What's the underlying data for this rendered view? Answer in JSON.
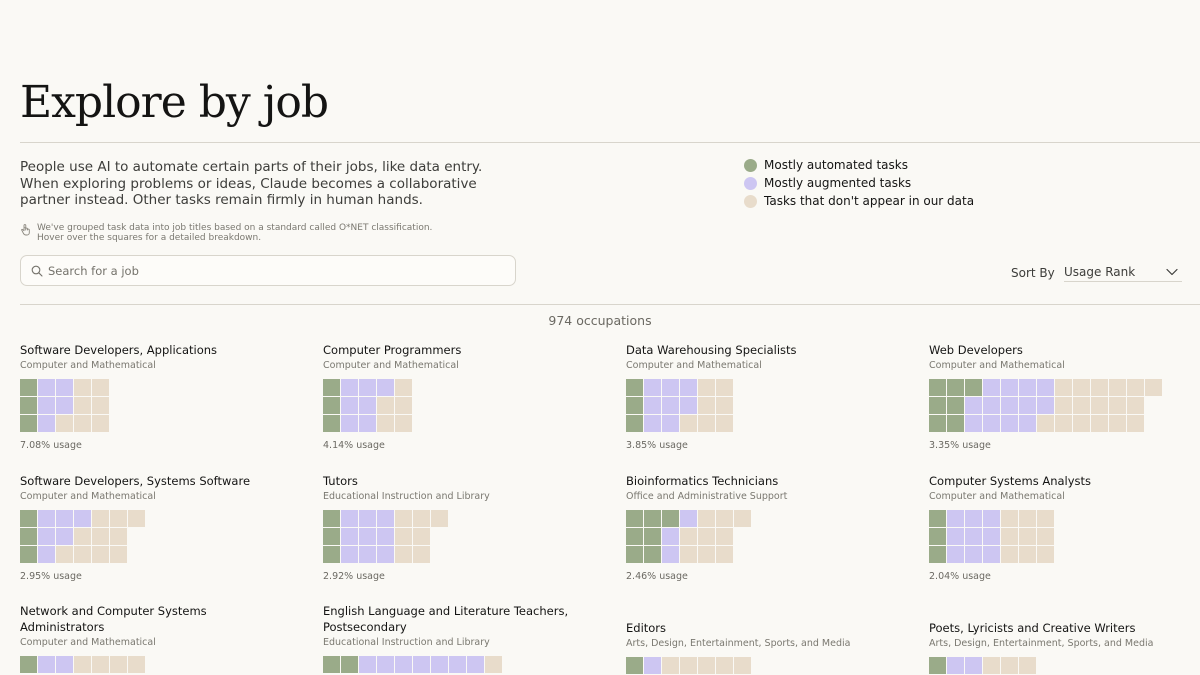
{
  "header": {
    "title": "Explore by job"
  },
  "intro": {
    "text": "People use AI to automate certain parts of their jobs, like data entry. When exploring problems or ideas, Claude becomes a collaborative partner instead. Other tasks remain firmly in human hands.",
    "note": "We've grouped task data into job titles based on a standard called O*NET classification. Hover over the squares for a detailed breakdown.",
    "note_icon": "pointer-hand-icon"
  },
  "legend": [
    {
      "key": "automated",
      "label": "Mostly automated tasks",
      "color": "#9aab89"
    },
    {
      "key": "augmented",
      "label": "Mostly augmented tasks",
      "color": "#cdc6f2"
    },
    {
      "key": "human",
      "label": "Tasks that don't appear in our data",
      "color": "#e8dccb"
    }
  ],
  "search": {
    "placeholder": "Search for a job",
    "value": "",
    "icon": "search-icon"
  },
  "sort": {
    "label": "Sort By",
    "value": "Usage Rank",
    "icon": "chevron-down-icon"
  },
  "count_text": "974 occupations",
  "occupations": [
    {
      "title": "Software Developers, Applications",
      "category": "Computer and Mathematical",
      "usage": "7.08% usage",
      "rows": [
        [
          "a",
          "b",
          "b",
          "h",
          "h"
        ],
        [
          "a",
          "b",
          "b",
          "h",
          "h"
        ],
        [
          "a",
          "b",
          "h",
          "h",
          "h"
        ]
      ]
    },
    {
      "title": "Computer Programmers",
      "category": "Computer and Mathematical",
      "usage": "4.14% usage",
      "rows": [
        [
          "a",
          "b",
          "b",
          "b",
          "h"
        ],
        [
          "a",
          "b",
          "b",
          "h",
          "h"
        ],
        [
          "a",
          "b",
          "b",
          "h",
          "h"
        ]
      ]
    },
    {
      "title": "Data Warehousing Specialists",
      "category": "Computer and Mathematical",
      "usage": "3.85% usage",
      "rows": [
        [
          "a",
          "b",
          "b",
          "b",
          "h",
          "h"
        ],
        [
          "a",
          "b",
          "b",
          "b",
          "h",
          "h"
        ],
        [
          "a",
          "b",
          "b",
          "h",
          "h",
          "h"
        ]
      ]
    },
    {
      "title": "Web Developers",
      "category": "Computer and Mathematical",
      "usage": "3.35% usage",
      "rows": [
        [
          "a",
          "a",
          "a",
          "b",
          "b",
          "b",
          "b",
          "h",
          "h",
          "h",
          "h",
          "h",
          "h"
        ],
        [
          "a",
          "a",
          "b",
          "b",
          "b",
          "b",
          "b",
          "h",
          "h",
          "h",
          "h",
          "h"
        ],
        [
          "a",
          "a",
          "b",
          "b",
          "b",
          "b",
          "h",
          "h",
          "h",
          "h",
          "h",
          "h"
        ]
      ]
    },
    {
      "title": "Software Developers, Systems Software",
      "category": "Computer and Mathematical",
      "usage": "2.95% usage",
      "rows": [
        [
          "a",
          "b",
          "b",
          "b",
          "h",
          "h",
          "h"
        ],
        [
          "a",
          "b",
          "b",
          "h",
          "h",
          "h"
        ],
        [
          "a",
          "b",
          "h",
          "h",
          "h",
          "h"
        ]
      ]
    },
    {
      "title": "Tutors",
      "category": "Educational Instruction and Library",
      "usage": "2.92% usage",
      "rows": [
        [
          "a",
          "b",
          "b",
          "b",
          "h",
          "h",
          "h"
        ],
        [
          "a",
          "b",
          "b",
          "b",
          "h",
          "h"
        ],
        [
          "a",
          "b",
          "b",
          "b",
          "h",
          "h"
        ]
      ]
    },
    {
      "title": "Bioinformatics Technicians",
      "category": "Office and Administrative Support",
      "usage": "2.46% usage",
      "rows": [
        [
          "a",
          "a",
          "a",
          "b",
          "h",
          "h",
          "h"
        ],
        [
          "a",
          "a",
          "b",
          "h",
          "h",
          "h"
        ],
        [
          "a",
          "a",
          "b",
          "h",
          "h",
          "h"
        ]
      ]
    },
    {
      "title": "Computer Systems Analysts",
      "category": "Computer and Mathematical",
      "usage": "2.04% usage",
      "rows": [
        [
          "a",
          "b",
          "b",
          "b",
          "h",
          "h",
          "h"
        ],
        [
          "a",
          "b",
          "b",
          "b",
          "h",
          "h",
          "h"
        ],
        [
          "a",
          "b",
          "b",
          "b",
          "h",
          "h",
          "h"
        ]
      ]
    },
    {
      "title": "Network and Computer Systems Administrators",
      "category": "Computer and Mathematical",
      "usage": "",
      "rows": [
        [
          "a",
          "b",
          "b",
          "h",
          "h",
          "h",
          "h"
        ]
      ]
    },
    {
      "title": "English Language and Literature Teachers, Postsecondary",
      "category": "Educational Instruction and Library",
      "usage": "",
      "rows": [
        [
          "a",
          "a",
          "b",
          "b",
          "b",
          "b",
          "b",
          "b",
          "b",
          "h"
        ]
      ]
    },
    {
      "title": "Editors",
      "category": "Arts, Design, Entertainment, Sports, and Media",
      "usage": "",
      "rows": [
        [
          "a",
          "b",
          "h",
          "h",
          "h",
          "h",
          "h"
        ]
      ]
    },
    {
      "title": "Poets, Lyricists and Creative Writers",
      "category": "Arts, Design, Entertainment, Sports, and Media",
      "usage": "",
      "rows": [
        [
          "a",
          "b",
          "b",
          "h",
          "h",
          "h"
        ]
      ]
    }
  ]
}
